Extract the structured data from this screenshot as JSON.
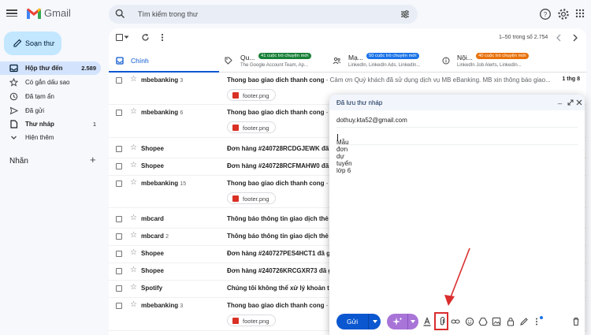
{
  "header": {
    "app_name": "Gmail",
    "search_placeholder": "Tìm kiếm trong thư",
    "icons": [
      "menu-icon",
      "gmail-logo",
      "search-icon",
      "filter-icon",
      "help-icon",
      "settings-icon",
      "apps-icon",
      "avatar"
    ]
  },
  "sidebar": {
    "compose_label": "Soạn thư",
    "items": [
      {
        "label": "Hộp thư đến",
        "count": "2.589",
        "icon": "inbox-icon"
      },
      {
        "label": "Có gắn dấu sao",
        "count": "",
        "icon": "star-icon"
      },
      {
        "label": "Đã tạm ẩn",
        "count": "",
        "icon": "clock-icon"
      },
      {
        "label": "Đã gửi",
        "count": "",
        "icon": "send-icon"
      },
      {
        "label": "Thư nháp",
        "count": "1",
        "icon": "draft-icon"
      },
      {
        "label": "Hiện thêm",
        "count": "",
        "icon": "chevron-down-icon"
      }
    ],
    "labels_title": "Nhãn",
    "labels_add": "+"
  },
  "toolbar": {
    "pager_text": "1–50 trong số 2.754"
  },
  "tabs": [
    {
      "label": "Chính",
      "badge": "",
      "sub": "",
      "icon": "inbox-icon"
    },
    {
      "label": "Qu...",
      "badge": "41 cuộc trò chuyện mới",
      "badge_color": "#188038",
      "sub": "The Google Account Team, Ap...",
      "icon": "tag-icon"
    },
    {
      "label": "Mạ...",
      "badge": "50 cuộc trò chuyện mới",
      "badge_color": "#1a73e8",
      "sub": "LinkedIn, LinkedIn Ads, LinkedIn...",
      "icon": "people-icon"
    },
    {
      "label": "Nội...",
      "badge": "40 cuộc trò chuyện mới",
      "badge_color": "#e8710a",
      "sub": "LinkedIn Job Alerts, LinkedIn...",
      "icon": "info-icon"
    }
  ],
  "emails": [
    {
      "sender": "mbebanking",
      "count": "3",
      "subject": "Thong bao giao dich thanh cong",
      "snippet": " - Cảm ơn Quý khách đã sử dụng dịch vụ MB eBanking. MB xin thông báo giao...",
      "date": "1 thg 8",
      "attachment": "footer.png"
    },
    {
      "sender": "mbebanking",
      "count": "6",
      "subject": "Thong bao giao dich thanh cong",
      "snippet": " - C",
      "date": "",
      "attachment": "footer.png"
    },
    {
      "sender": "Shopee",
      "count": "",
      "subject": "Đơn hàng #240728RCDGJEWK đã gi",
      "snippet": "",
      "date": "",
      "attachment": ""
    },
    {
      "sender": "Shopee",
      "count": "",
      "subject": "Đơn hàng #240728RCFMAHW0 đã",
      "snippet": "",
      "date": "",
      "attachment": ""
    },
    {
      "sender": "mbebanking",
      "count": "15",
      "subject": "Thong bao giao dich thanh cong",
      "snippet": " - C",
      "date": "",
      "attachment": "footer.png"
    },
    {
      "sender": "mbcard",
      "count": "",
      "subject": "Thông báo thông tin giao dịch thẻ",
      "snippet": " -",
      "date": "",
      "attachment": ""
    },
    {
      "sender": "mbcard",
      "count": "2",
      "subject": "Thông báo thông tin giao dịch thẻ",
      "snippet": " -",
      "date": "",
      "attachment": ""
    },
    {
      "sender": "Shopee",
      "count": "",
      "subject": "Đơn hàng #240727PES4HCT1 đã gi",
      "snippet": "",
      "date": "",
      "attachment": ""
    },
    {
      "sender": "Shopee",
      "count": "",
      "subject": "Đơn hàng #240726KRCGXR73 đã g",
      "snippet": "",
      "date": "",
      "attachment": ""
    },
    {
      "sender": "Spotify",
      "count": "",
      "subject": "Chúng tôi không thể xử lý khoản th",
      "snippet": "",
      "date": "",
      "attachment": ""
    },
    {
      "sender": "mbebanking",
      "count": "3",
      "subject": "Thong bao giao dich thanh cong",
      "snippet": " - C",
      "date": "",
      "attachment": "footer.png"
    }
  ],
  "compose_window": {
    "title": "Đã lưu thư nháp",
    "to": "dothuy.kta52@gmail.com",
    "subject": "Mẫu đơn dự tuyển lớp 6",
    "send_label": "Gửi",
    "format_icons": [
      "text-format-icon",
      "attach-file-icon",
      "link-icon",
      "emoji-icon",
      "drive-icon",
      "image-icon",
      "lock-icon",
      "signature-icon",
      "more-options-icon",
      "delete-icon"
    ],
    "highlighted_icon": "attach-file-icon",
    "highlight_color": "#d92d2d"
  }
}
